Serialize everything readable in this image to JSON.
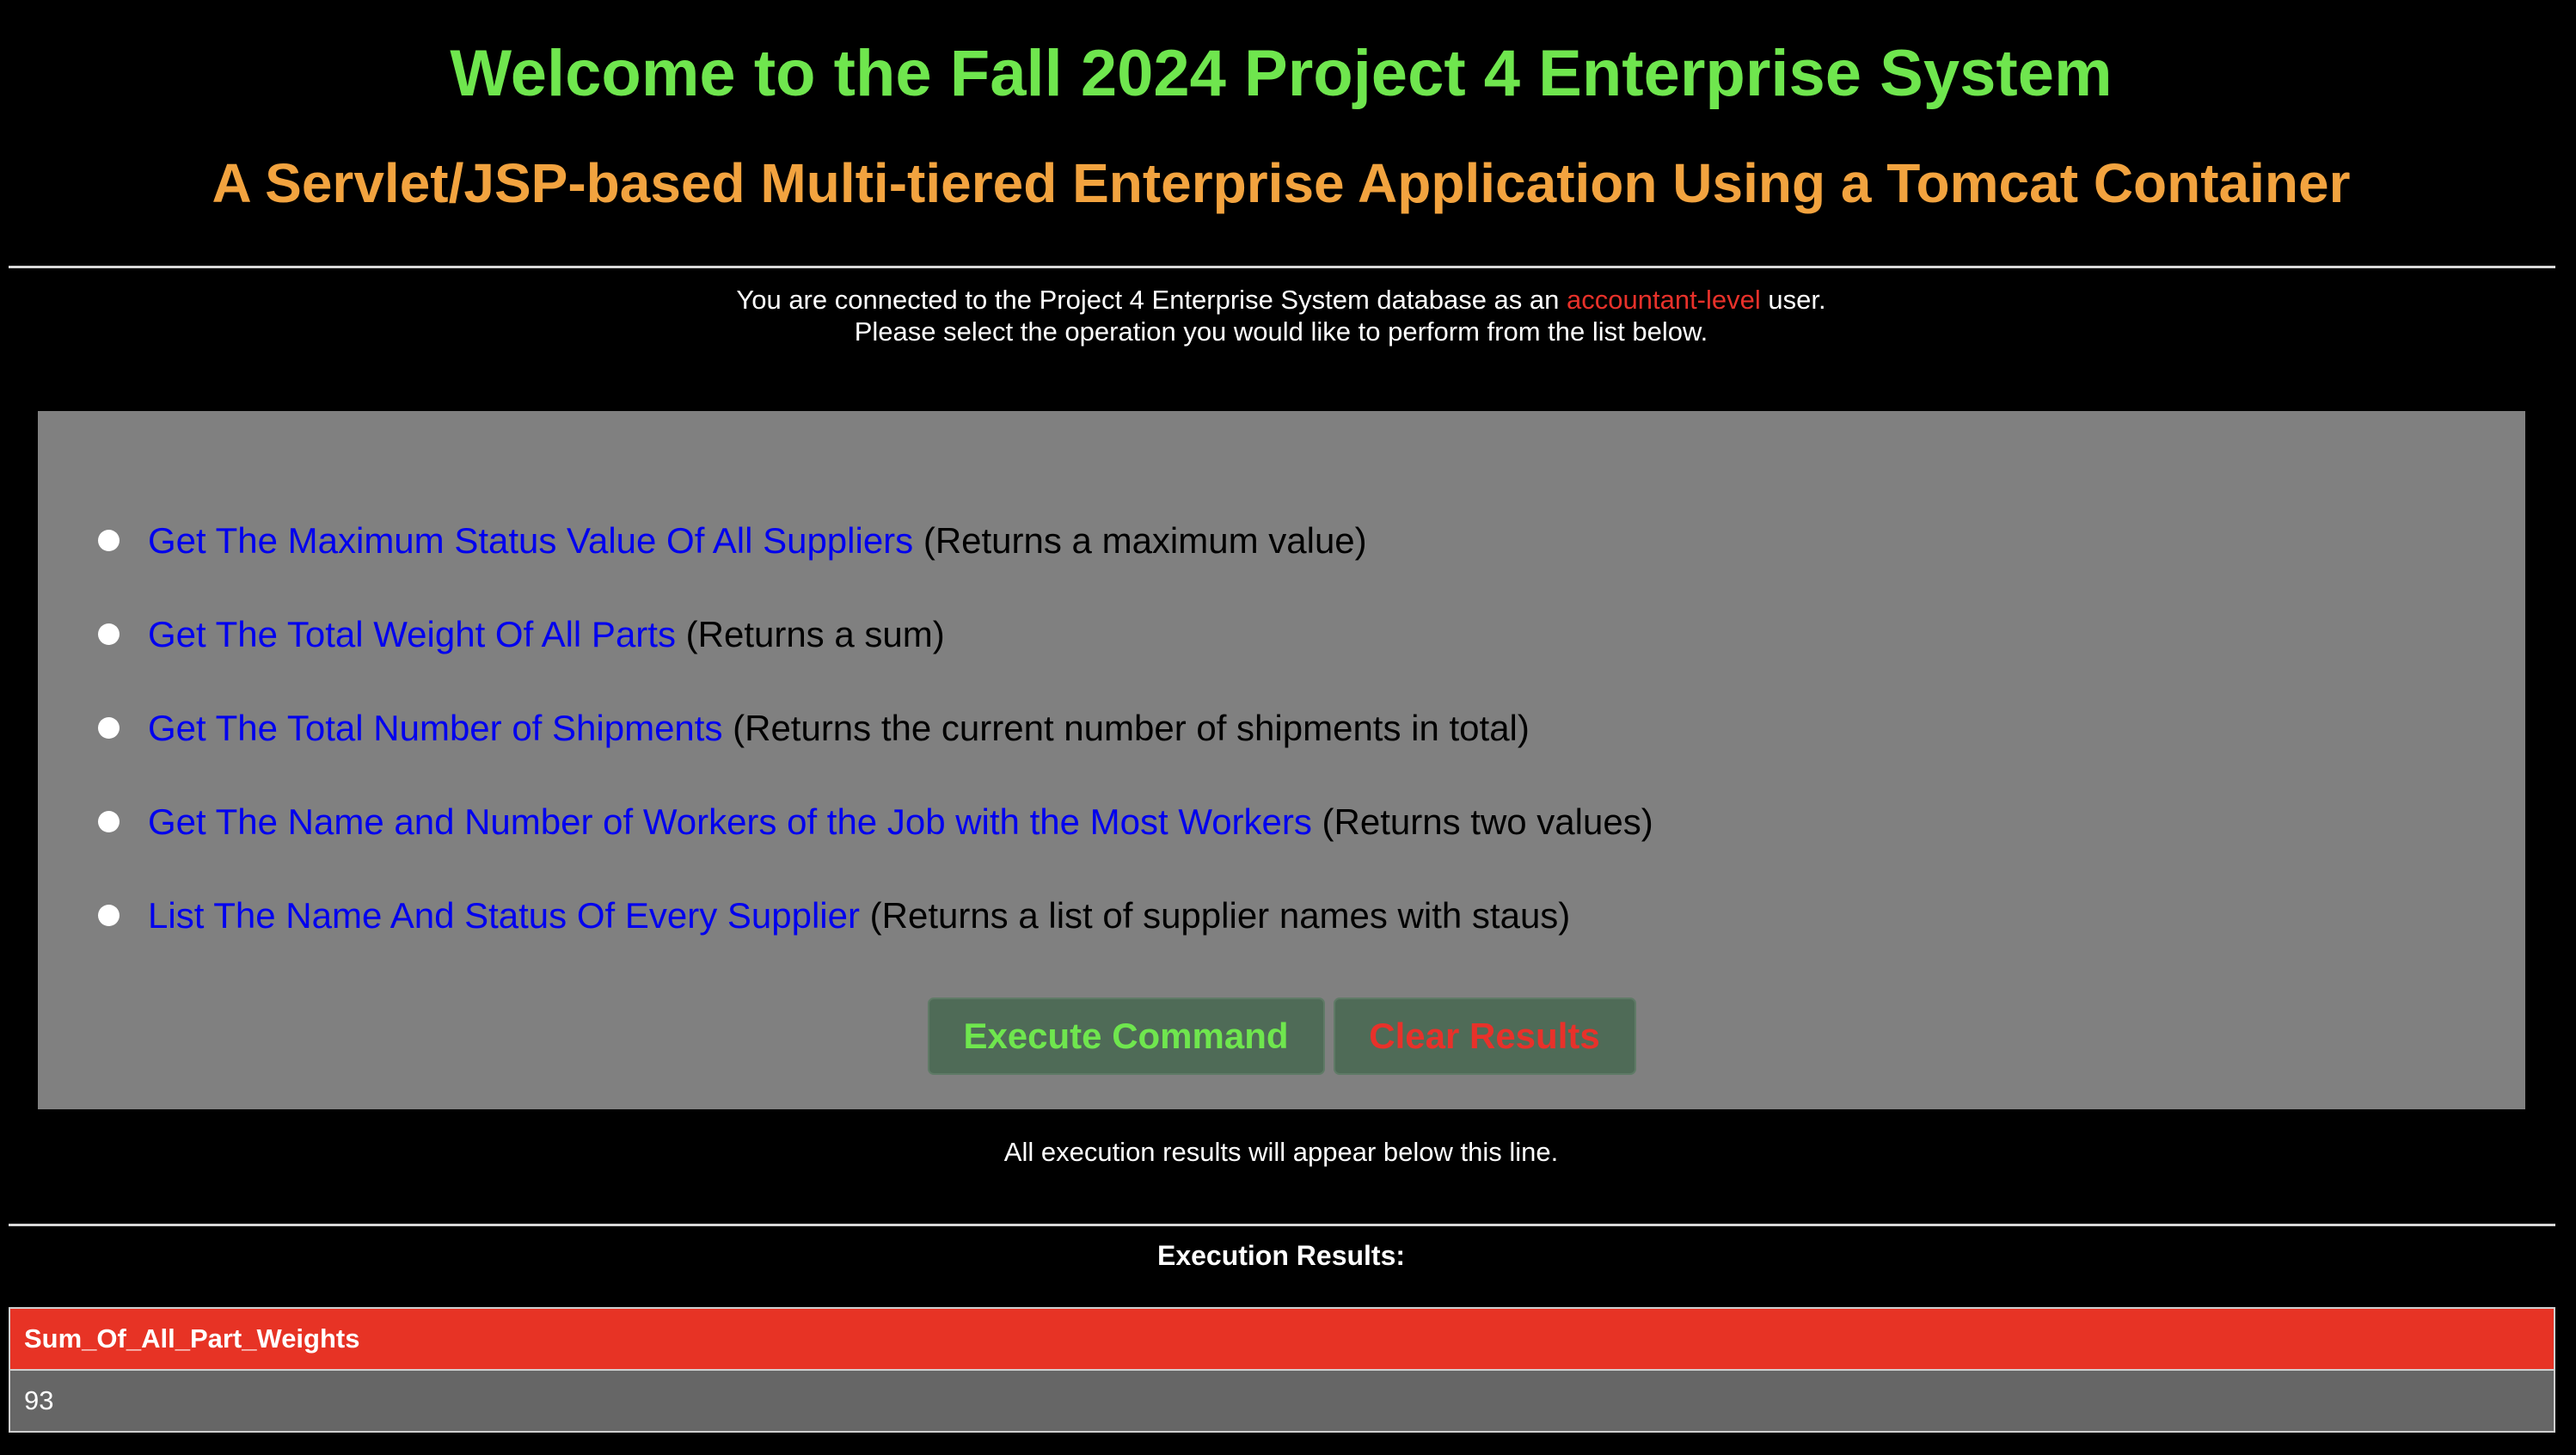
{
  "header": {
    "title": "Welcome to the Fall 2024 Project 4 Enterprise System",
    "subtitle": "A Servlet/JSP-based Multi-tiered Enterprise Application Using a Tomcat Container"
  },
  "connection_info": {
    "line1_prefix": "You are connected to the Project 4 Enterprise System database as an ",
    "role": "accountant-level",
    "line1_suffix": " user.",
    "line2": "Please select the operation you would like to perform from the list below."
  },
  "operations": [
    {
      "link": "Get The Maximum Status Value Of All Suppliers",
      "desc": " (Returns a maximum value)"
    },
    {
      "link": "Get The Total Weight Of All Parts",
      "desc": " (Returns a sum)"
    },
    {
      "link": "Get The Total Number of Shipments",
      "desc": " (Returns the current number of shipments in total)"
    },
    {
      "link": "Get The Name and Number of Workers of the Job with the Most Workers",
      "desc": " (Returns two values)"
    },
    {
      "link": "List The Name And Status Of Every Supplier",
      "desc": " (Returns a list of supplier names with staus)"
    }
  ],
  "buttons": {
    "execute": "Execute Command",
    "clear": "Clear Results"
  },
  "note": "All execution results will appear below this line.",
  "results": {
    "label": "Execution Results:",
    "columns": [
      "Sum_Of_All_Part_Weights"
    ],
    "rows": [
      [
        "93"
      ]
    ]
  },
  "colors": {
    "title": "#6fe64e",
    "subtitle": "#f2a33f",
    "role": "#e8312a",
    "link": "#0000ee",
    "panel": "#808080",
    "table_header": "#e73325"
  }
}
